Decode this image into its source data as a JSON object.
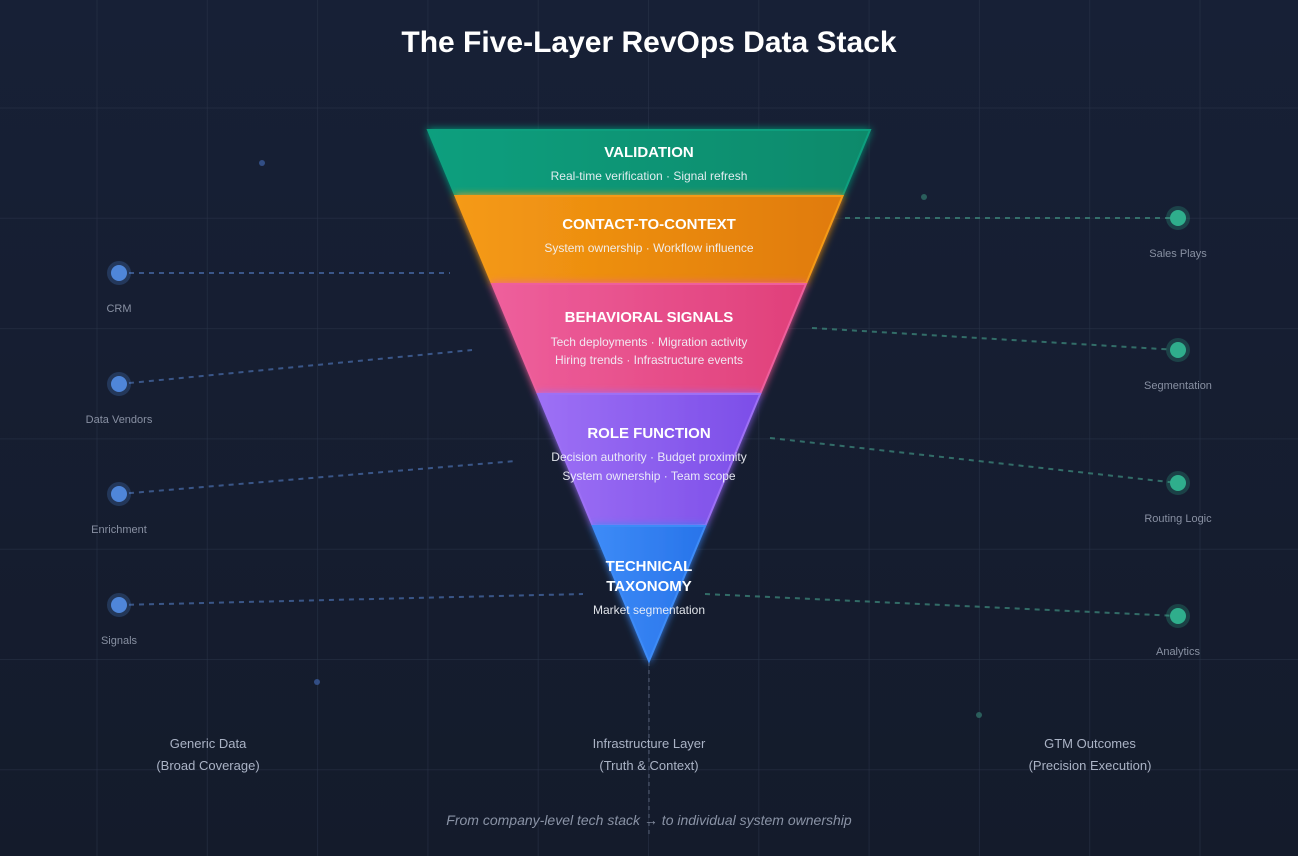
{
  "title": "The Five-Layer RevOps Data Stack",
  "colors": {
    "background_top": "#172036",
    "background_bottom": "#141b2b",
    "grid": "#2a3449",
    "left_node": "#4f86d9",
    "right_node": "#2fae8c"
  },
  "layers": [
    {
      "name": "VALIDATION",
      "lines": [
        "Real-time verification · Signal refresh"
      ],
      "colors": [
        "#0f9f7e",
        "#0c8a6b"
      ]
    },
    {
      "name": "CONTACT-TO-CONTEXT",
      "lines": [
        "System ownership · Workflow influence"
      ],
      "colors": [
        "#f59a14",
        "#e07b0b"
      ]
    },
    {
      "name": "BEHAVIORAL SIGNALS",
      "lines": [
        "Tech deployments · Migration activity",
        "Hiring trends · Infrastructure events"
      ],
      "colors": [
        "#ee5f9c",
        "#e0407a"
      ]
    },
    {
      "name": "ROLE FUNCTION",
      "lines": [
        "Decision authority · Budget proximity",
        "System ownership · Team scope"
      ],
      "colors": [
        "#9d70f5",
        "#7c4ee8"
      ]
    },
    {
      "name_lines": [
        "TECHNICAL",
        "TAXONOMY"
      ],
      "lines": [
        "Market segmentation"
      ],
      "colors": [
        "#3d8bf7",
        "#2874ea"
      ]
    }
  ],
  "left_nodes": [
    {
      "label": "CRM"
    },
    {
      "label": "Data Vendors"
    },
    {
      "label": "Enrichment"
    },
    {
      "label": "Signals"
    }
  ],
  "right_nodes": [
    {
      "label": "Sales Plays"
    },
    {
      "label": "Segmentation"
    },
    {
      "label": "Routing Logic"
    },
    {
      "label": "Analytics"
    }
  ],
  "columns": [
    {
      "title": "Generic Data",
      "subtitle": "(Broad Coverage)"
    },
    {
      "title": "Infrastructure Layer",
      "subtitle": "(Truth & Context)"
    },
    {
      "title": "GTM Outcomes",
      "subtitle": "(Precision Execution)"
    }
  ],
  "footnote": "From company-level tech stack → to individual system ownership"
}
